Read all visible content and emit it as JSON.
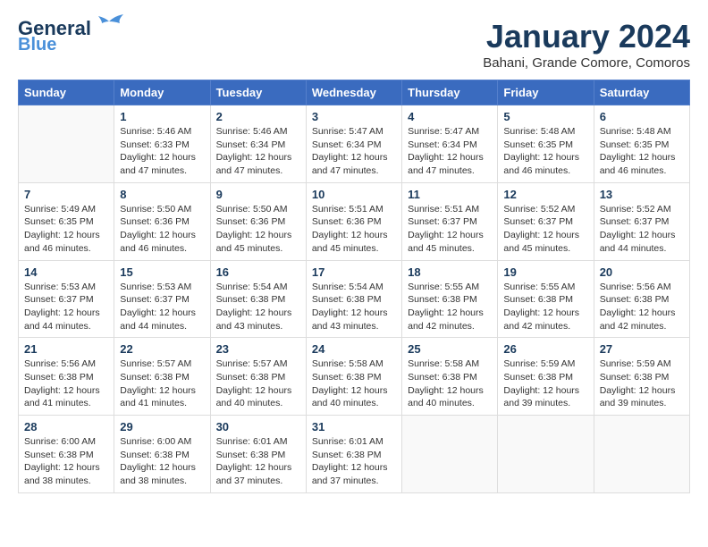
{
  "header": {
    "logo_line1": "General",
    "logo_line2": "Blue",
    "month_title": "January 2024",
    "subtitle": "Bahani, Grande Comore, Comoros"
  },
  "days_of_week": [
    "Sunday",
    "Monday",
    "Tuesday",
    "Wednesday",
    "Thursday",
    "Friday",
    "Saturday"
  ],
  "weeks": [
    [
      {
        "num": "",
        "sunrise": "",
        "sunset": "",
        "daylight": ""
      },
      {
        "num": "1",
        "sunrise": "Sunrise: 5:46 AM",
        "sunset": "Sunset: 6:33 PM",
        "daylight": "Daylight: 12 hours and 47 minutes."
      },
      {
        "num": "2",
        "sunrise": "Sunrise: 5:46 AM",
        "sunset": "Sunset: 6:34 PM",
        "daylight": "Daylight: 12 hours and 47 minutes."
      },
      {
        "num": "3",
        "sunrise": "Sunrise: 5:47 AM",
        "sunset": "Sunset: 6:34 PM",
        "daylight": "Daylight: 12 hours and 47 minutes."
      },
      {
        "num": "4",
        "sunrise": "Sunrise: 5:47 AM",
        "sunset": "Sunset: 6:34 PM",
        "daylight": "Daylight: 12 hours and 47 minutes."
      },
      {
        "num": "5",
        "sunrise": "Sunrise: 5:48 AM",
        "sunset": "Sunset: 6:35 PM",
        "daylight": "Daylight: 12 hours and 46 minutes."
      },
      {
        "num": "6",
        "sunrise": "Sunrise: 5:48 AM",
        "sunset": "Sunset: 6:35 PM",
        "daylight": "Daylight: 12 hours and 46 minutes."
      }
    ],
    [
      {
        "num": "7",
        "sunrise": "Sunrise: 5:49 AM",
        "sunset": "Sunset: 6:35 PM",
        "daylight": "Daylight: 12 hours and 46 minutes."
      },
      {
        "num": "8",
        "sunrise": "Sunrise: 5:50 AM",
        "sunset": "Sunset: 6:36 PM",
        "daylight": "Daylight: 12 hours and 46 minutes."
      },
      {
        "num": "9",
        "sunrise": "Sunrise: 5:50 AM",
        "sunset": "Sunset: 6:36 PM",
        "daylight": "Daylight: 12 hours and 45 minutes."
      },
      {
        "num": "10",
        "sunrise": "Sunrise: 5:51 AM",
        "sunset": "Sunset: 6:36 PM",
        "daylight": "Daylight: 12 hours and 45 minutes."
      },
      {
        "num": "11",
        "sunrise": "Sunrise: 5:51 AM",
        "sunset": "Sunset: 6:37 PM",
        "daylight": "Daylight: 12 hours and 45 minutes."
      },
      {
        "num": "12",
        "sunrise": "Sunrise: 5:52 AM",
        "sunset": "Sunset: 6:37 PM",
        "daylight": "Daylight: 12 hours and 45 minutes."
      },
      {
        "num": "13",
        "sunrise": "Sunrise: 5:52 AM",
        "sunset": "Sunset: 6:37 PM",
        "daylight": "Daylight: 12 hours and 44 minutes."
      }
    ],
    [
      {
        "num": "14",
        "sunrise": "Sunrise: 5:53 AM",
        "sunset": "Sunset: 6:37 PM",
        "daylight": "Daylight: 12 hours and 44 minutes."
      },
      {
        "num": "15",
        "sunrise": "Sunrise: 5:53 AM",
        "sunset": "Sunset: 6:37 PM",
        "daylight": "Daylight: 12 hours and 44 minutes."
      },
      {
        "num": "16",
        "sunrise": "Sunrise: 5:54 AM",
        "sunset": "Sunset: 6:38 PM",
        "daylight": "Daylight: 12 hours and 43 minutes."
      },
      {
        "num": "17",
        "sunrise": "Sunrise: 5:54 AM",
        "sunset": "Sunset: 6:38 PM",
        "daylight": "Daylight: 12 hours and 43 minutes."
      },
      {
        "num": "18",
        "sunrise": "Sunrise: 5:55 AM",
        "sunset": "Sunset: 6:38 PM",
        "daylight": "Daylight: 12 hours and 42 minutes."
      },
      {
        "num": "19",
        "sunrise": "Sunrise: 5:55 AM",
        "sunset": "Sunset: 6:38 PM",
        "daylight": "Daylight: 12 hours and 42 minutes."
      },
      {
        "num": "20",
        "sunrise": "Sunrise: 5:56 AM",
        "sunset": "Sunset: 6:38 PM",
        "daylight": "Daylight: 12 hours and 42 minutes."
      }
    ],
    [
      {
        "num": "21",
        "sunrise": "Sunrise: 5:56 AM",
        "sunset": "Sunset: 6:38 PM",
        "daylight": "Daylight: 12 hours and 41 minutes."
      },
      {
        "num": "22",
        "sunrise": "Sunrise: 5:57 AM",
        "sunset": "Sunset: 6:38 PM",
        "daylight": "Daylight: 12 hours and 41 minutes."
      },
      {
        "num": "23",
        "sunrise": "Sunrise: 5:57 AM",
        "sunset": "Sunset: 6:38 PM",
        "daylight": "Daylight: 12 hours and 40 minutes."
      },
      {
        "num": "24",
        "sunrise": "Sunrise: 5:58 AM",
        "sunset": "Sunset: 6:38 PM",
        "daylight": "Daylight: 12 hours and 40 minutes."
      },
      {
        "num": "25",
        "sunrise": "Sunrise: 5:58 AM",
        "sunset": "Sunset: 6:38 PM",
        "daylight": "Daylight: 12 hours and 40 minutes."
      },
      {
        "num": "26",
        "sunrise": "Sunrise: 5:59 AM",
        "sunset": "Sunset: 6:38 PM",
        "daylight": "Daylight: 12 hours and 39 minutes."
      },
      {
        "num": "27",
        "sunrise": "Sunrise: 5:59 AM",
        "sunset": "Sunset: 6:38 PM",
        "daylight": "Daylight: 12 hours and 39 minutes."
      }
    ],
    [
      {
        "num": "28",
        "sunrise": "Sunrise: 6:00 AM",
        "sunset": "Sunset: 6:38 PM",
        "daylight": "Daylight: 12 hours and 38 minutes."
      },
      {
        "num": "29",
        "sunrise": "Sunrise: 6:00 AM",
        "sunset": "Sunset: 6:38 PM",
        "daylight": "Daylight: 12 hours and 38 minutes."
      },
      {
        "num": "30",
        "sunrise": "Sunrise: 6:01 AM",
        "sunset": "Sunset: 6:38 PM",
        "daylight": "Daylight: 12 hours and 37 minutes."
      },
      {
        "num": "31",
        "sunrise": "Sunrise: 6:01 AM",
        "sunset": "Sunset: 6:38 PM",
        "daylight": "Daylight: 12 hours and 37 minutes."
      },
      {
        "num": "",
        "sunrise": "",
        "sunset": "",
        "daylight": ""
      },
      {
        "num": "",
        "sunrise": "",
        "sunset": "",
        "daylight": ""
      },
      {
        "num": "",
        "sunrise": "",
        "sunset": "",
        "daylight": ""
      }
    ]
  ]
}
